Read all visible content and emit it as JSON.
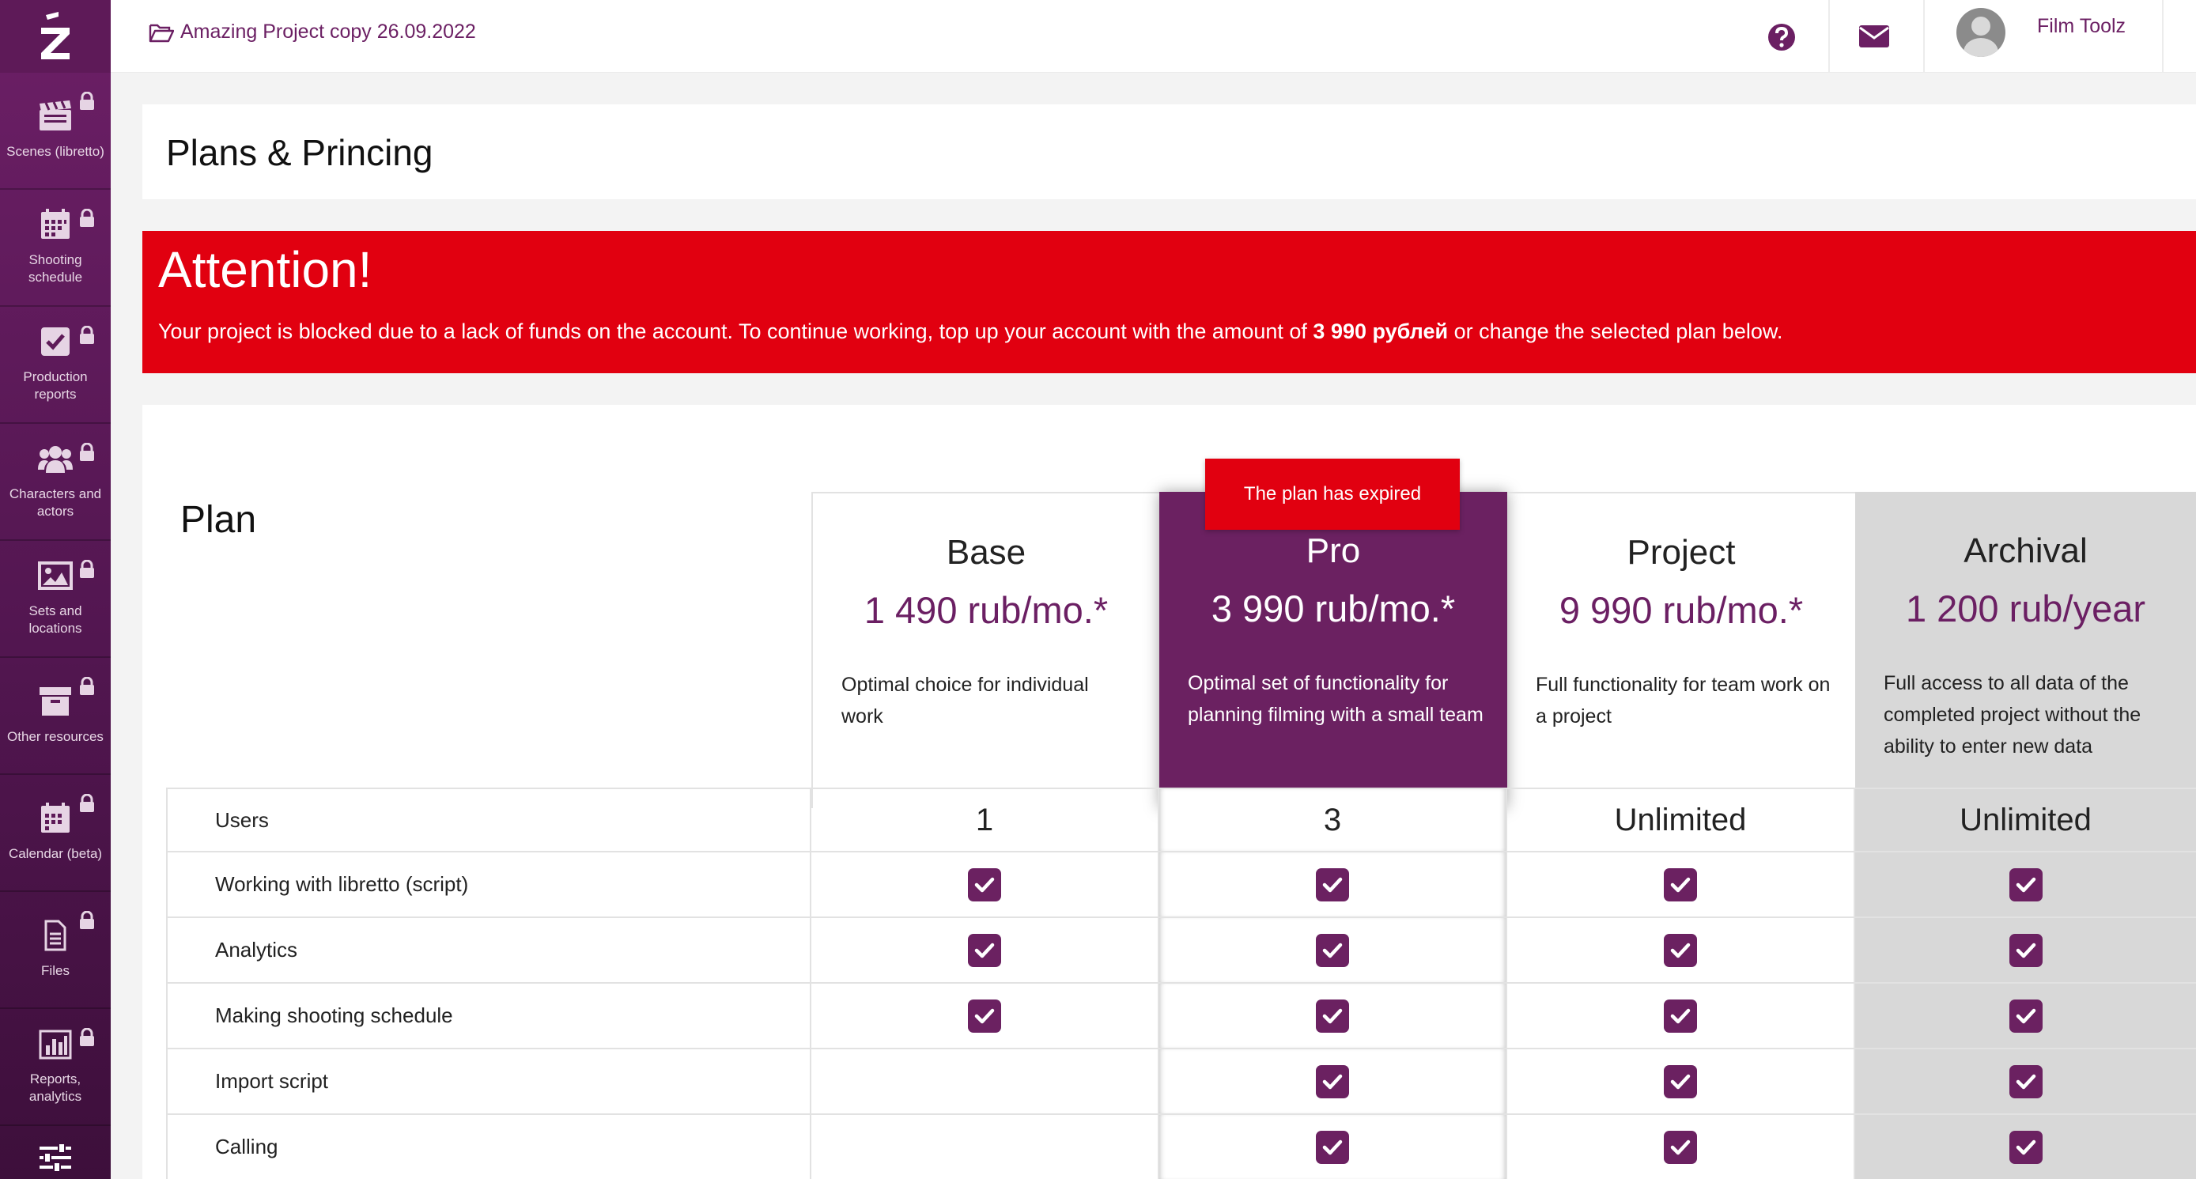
{
  "sidebar": {
    "logo": "Z",
    "items": [
      {
        "label": "Scenes (libretto)",
        "icon": "clapperboard-icon"
      },
      {
        "label": "Shooting schedule",
        "icon": "calendar-grid-icon"
      },
      {
        "label": "Production reports",
        "icon": "checkbox-icon"
      },
      {
        "label": "Characters and actors",
        "icon": "users-icon"
      },
      {
        "label": "Sets and locations",
        "icon": "image-icon"
      },
      {
        "label": "Other resources",
        "icon": "archive-box-icon"
      },
      {
        "label": "Calendar (beta)",
        "icon": "calendar-icon"
      },
      {
        "label": "Files",
        "icon": "file-icon"
      },
      {
        "label": "Reports, analytics",
        "icon": "bar-chart-icon"
      }
    ],
    "bottom_icon": "sliders-icon"
  },
  "topbar": {
    "project_name": "Amazing Project copy 26.09.2022",
    "user_name": "Film Toolz"
  },
  "page": {
    "title": "Plans & Princing"
  },
  "alert": {
    "title": "Attention!",
    "text_before": "Your project is blocked due to a lack of funds on the account. To continue working, top up your account with the amount of ",
    "amount": "3 990 рублей",
    "text_after": " or change the selected plan below."
  },
  "plans": {
    "heading": "Plan",
    "expired_badge": "The plan has expired",
    "columns": [
      {
        "name": "Base",
        "price": "1 490 rub/mo.*",
        "desc": "Optimal choice for individual work"
      },
      {
        "name": "Pro",
        "price": "3 990 rub/mo.*",
        "desc": "Optimal set of functionality for planning filming with a small team"
      },
      {
        "name": "Project",
        "price": "9 990 rub/mo.*",
        "desc": "Full functionality for team work on a project"
      },
      {
        "name": "Archival",
        "price": "1 200 rub/year",
        "desc": "Full access to all data of the completed project without the ability to enter new data"
      }
    ],
    "features": [
      {
        "name": "Users",
        "values": [
          "1",
          "3",
          "Unlimited",
          "Unlimited"
        ]
      },
      {
        "name": "Working with libretto (script)",
        "checks": [
          true,
          true,
          true,
          true
        ]
      },
      {
        "name": "Analytics",
        "checks": [
          true,
          true,
          true,
          true
        ]
      },
      {
        "name": "Making shooting schedule",
        "checks": [
          true,
          true,
          true,
          true
        ]
      },
      {
        "name": "Import script",
        "checks": [
          false,
          true,
          true,
          true
        ]
      },
      {
        "name": "Calling",
        "checks": [
          false,
          true,
          true,
          true
        ]
      }
    ]
  },
  "colors": {
    "brand": "#6b2161",
    "alert": "#e10010",
    "archival_bg": "#d8d8d8"
  }
}
